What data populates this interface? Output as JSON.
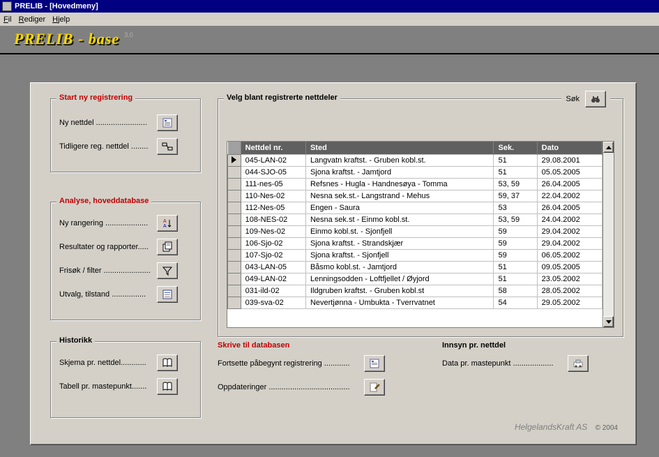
{
  "window": {
    "title": "PRELIB - [Hovedmeny]"
  },
  "menu": {
    "fil": "Fil",
    "rediger": "Rediger",
    "hjelp": "Hjelp"
  },
  "app": {
    "logo": "PRELIB - base",
    "version": "3.0"
  },
  "groups": {
    "start": {
      "legend": "Start ny registrering",
      "ny_nettdel": "Ny nettdel",
      "tidl_reg": "Tidligere reg. nettdel"
    },
    "analyse": {
      "legend": "Analyse, hoveddatabase",
      "ny_rangering": "Ny rangering",
      "resultater": "Resultater og rapporter",
      "frisok": "Frisøk / filter",
      "utvalg": "Utvalg, tilstand"
    },
    "historikk": {
      "legend": "Historikk",
      "skjema": "Skjema pr. nettdel",
      "tabell": "Tabell pr. mastepunkt"
    },
    "velg": {
      "legend": "Velg blant registrerte nettdeler",
      "sok_label": "Søk",
      "cols": {
        "id": "Nettdel  nr.",
        "sted": "Sted",
        "sek": "Sek.",
        "dato": "Dato"
      },
      "rows": [
        {
          "id": "045-LAN-02",
          "sted": "Langvatn kraftst. - Gruben kobl.st.",
          "sek": "51",
          "dato": "29.08.2001"
        },
        {
          "id": "044-SJO-05",
          "sted": "Sjona kraftst. - Jamtjord",
          "sek": "51",
          "dato": "05.05.2005"
        },
        {
          "id": "111-nes-05",
          "sted": "Refsnes - Hugla - Handnesøya - Tomma",
          "sek": "53, 59",
          "dato": "26.04.2005"
        },
        {
          "id": "110-Nes-02",
          "sted": "Nesna sek.st.- Langstrand - Mehus",
          "sek": "59, 37",
          "dato": "22.04.2002"
        },
        {
          "id": "112-Nes-05",
          "sted": "Engen - Saura",
          "sek": "53",
          "dato": "26.04.2005"
        },
        {
          "id": "108-NES-02",
          "sted": "Nesna sek.st - Einmo kobl.st.",
          "sek": "53, 59",
          "dato": "24.04.2002"
        },
        {
          "id": "109-Nes-02",
          "sted": "Einmo kobl.st. - Sjonfjell",
          "sek": "59",
          "dato": "29.04.2002"
        },
        {
          "id": "106-Sjo-02",
          "sted": "Sjona kraftst. - Strandskjær",
          "sek": "59",
          "dato": "29.04.2002"
        },
        {
          "id": "107-Sjo-02",
          "sted": "Sjona kraftst. - Sjonfjell",
          "sek": "59",
          "dato": "06.05.2002"
        },
        {
          "id": "043-LAN-05",
          "sted": "Båsmo kobl.st. - Jamtjord",
          "sek": "51",
          "dato": "09.05.2005"
        },
        {
          "id": "049-LAN-02",
          "sted": "Lenningsodden - Loftfjellet  /  Øyjord",
          "sek": "51",
          "dato": "23.05.2002"
        },
        {
          "id": "031-ild-02",
          "sted": "Ildgruben kraftst. - Gruben kobl.st",
          "sek": "58",
          "dato": "28.05.2002"
        },
        {
          "id": "039-sva-02",
          "sted": "Nevertjønna - Umbukta - Tverrvatnet",
          "sek": "54",
          "dato": "29.05.2002"
        }
      ]
    },
    "skrive": {
      "legend": "Skrive til databasen",
      "fortsette": "Fortsette påbegynt registrering",
      "oppdateringer": "Oppdateringer"
    },
    "innsyn": {
      "legend": "Innsyn pr. nettdel",
      "data_pr": "Data pr. mastepunkt"
    }
  },
  "footer": {
    "company": "HelgelandsKraft AS",
    "copy": "© 2004"
  }
}
